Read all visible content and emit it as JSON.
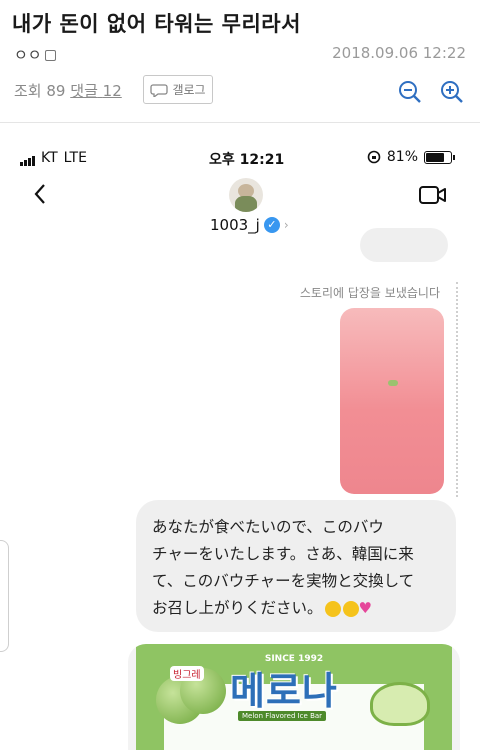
{
  "post": {
    "title": "내가 돈이 없어 타워는 무리라서",
    "author": "ㅇㅇ",
    "date": "2018.09.06 12:22",
    "views_label": "조회",
    "views": "89",
    "comments_label": "댓글",
    "comments": "12",
    "gallog_label": "갤로그"
  },
  "phone_status": {
    "carrier": "KT",
    "network": "LTE",
    "time": "오후 12:21",
    "battery": "81%"
  },
  "chat": {
    "username": "1003_j",
    "story_reply_label": "스토리에 답장을 보냈습니다",
    "message_text": "あなたが食べたいので、このバウ\nチャーをいたします。さあ、韓国に来\nて、このバウチャーを実物と交換して\nお召し上がりください。",
    "message_emojis": [
      "rofl-emoji",
      "rofl-emoji",
      "sparkling-heart-emoji"
    ]
  },
  "product": {
    "since": "SINCE 1992",
    "brand": "빙그레",
    "name": "메로나",
    "subtitle": "Melon Flavored Ice Bar"
  },
  "icons": [
    "zoom-out-icon",
    "zoom-in-icon",
    "back-icon",
    "video-call-icon",
    "verified-icon",
    "speech-bubble-icon"
  ],
  "colors": {
    "accent_blue": "#2f6fc1",
    "verified": "#3897f0",
    "melona_green": "#8fc463"
  }
}
